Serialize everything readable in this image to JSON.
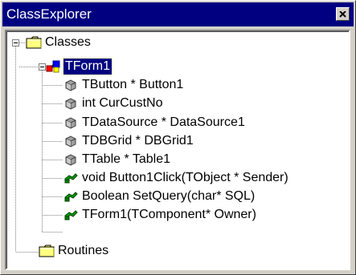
{
  "window": {
    "title": "ClassExplorer",
    "close_icon": "close-x-icon"
  },
  "tree": {
    "root": {
      "label": "Classes",
      "icon": "folder-icon",
      "expanded": true
    },
    "class_node": {
      "label": "TForm1",
      "icon": "class-icon",
      "expanded": true,
      "selected": true
    },
    "members": [
      {
        "label": "TButton * Button1",
        "icon": "field-icon"
      },
      {
        "label": "int CurCustNo",
        "icon": "field-icon"
      },
      {
        "label": "TDataSource * DataSource1",
        "icon": "field-icon"
      },
      {
        "label": "TDBGrid * DBGrid1",
        "icon": "field-icon"
      },
      {
        "label": "TTable * Table1",
        "icon": "field-icon"
      },
      {
        "label": "void Button1Click(TObject * Sender)",
        "icon": "method-icon"
      },
      {
        "label": "Boolean SetQuery(char* SQL)",
        "icon": "method-icon"
      },
      {
        "label": "TForm1(TComponent* Owner)",
        "icon": "method-icon"
      }
    ],
    "routines": {
      "label": "Routines",
      "icon": "folder-icon"
    }
  },
  "colors": {
    "titlebar": "#000080",
    "selection": "#000080",
    "folder": "#ffff80",
    "method": "#008000",
    "field": "#808080"
  }
}
